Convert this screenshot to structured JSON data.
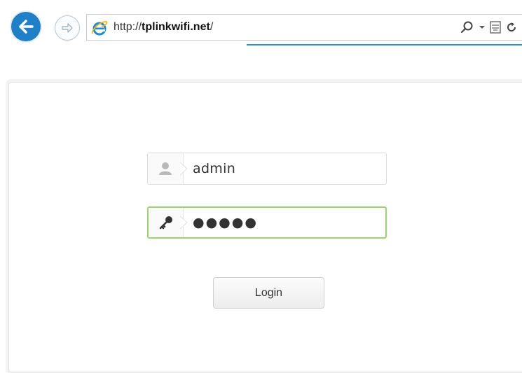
{
  "browser": {
    "url_prefix": "http://",
    "url_host": "tplinkwifi.net",
    "url_suffix": "/"
  },
  "login": {
    "username_value": "admin",
    "password_value": "●●●●●",
    "submit_label": "Login",
    "focus_color": "#9bd56d"
  }
}
